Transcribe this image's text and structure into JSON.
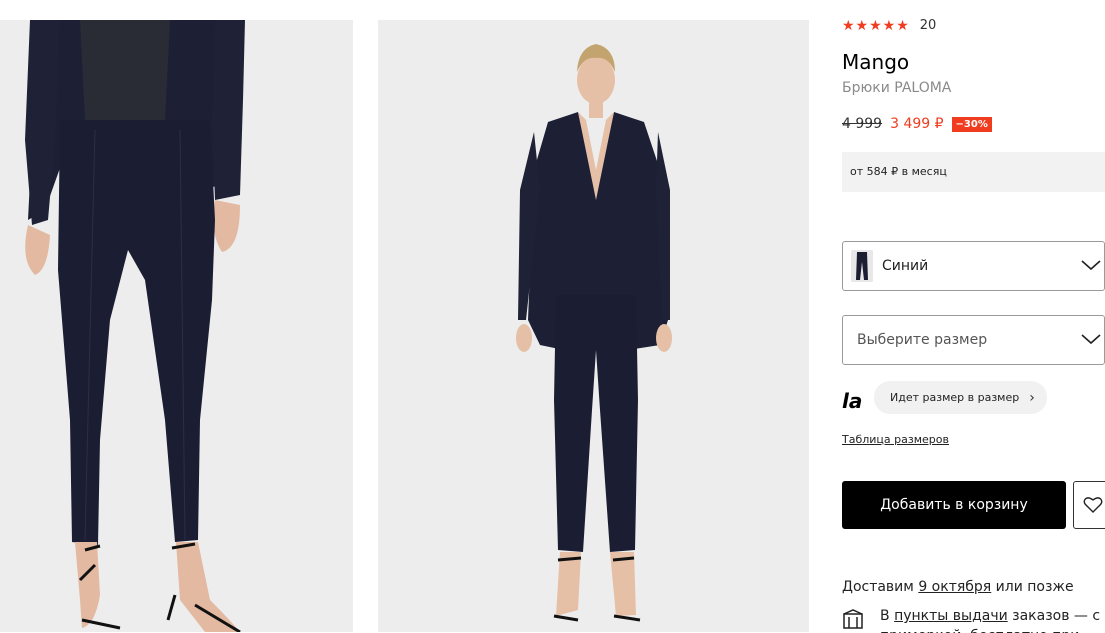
{
  "gallery": {
    "images": [
      {
        "alt": "close-up of navy trousers and heels"
      },
      {
        "alt": "model in navy suit"
      }
    ]
  },
  "product": {
    "rating_stars": "★★★★★",
    "rating_count": "20",
    "brand": "Mango",
    "name": "Брюки PALOMA",
    "old_price": "4 999",
    "new_price": "3 499 ₽",
    "discount": "−30%",
    "installment": "от 584 ₽ в месяц"
  },
  "color_select": {
    "value": "Синий"
  },
  "size_select": {
    "placeholder": "Выберите размер"
  },
  "fit": {
    "logo": "la",
    "label": "Идет размер в размер",
    "arrow": "›"
  },
  "size_table_link": "Таблица размеров",
  "cart_button": "Добавить в корзину",
  "delivery": {
    "prefix": "Доставим",
    "date": "9 октября",
    "suffix": "или позже"
  },
  "pickup": {
    "prefix": "В",
    "link": "пункты выдачи",
    "rest": "заказов — с примеркой, бесплатно при"
  },
  "colors": {
    "accent": "#f03c1f",
    "suit": "#1d2035",
    "background": "#ededed"
  }
}
